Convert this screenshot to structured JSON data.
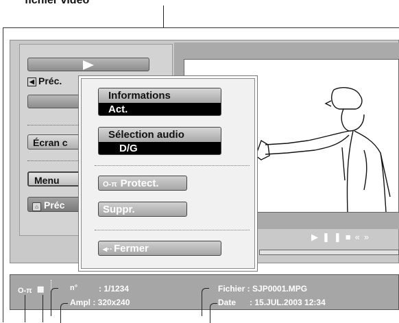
{
  "caption": "fichier vidéo",
  "left_panel": {
    "prev_label": "Préc.",
    "ecran_label": "Écran c",
    "menu_label": "Menu",
    "precedent_label": "Préc"
  },
  "popup": {
    "info_title": "Informations",
    "info_value": "Act.",
    "audio_title": "Sélection audio",
    "audio_value": "D/G",
    "protect_label": "Protect.",
    "suppr_label": "Suppr.",
    "fermer_label": "Fermer"
  },
  "info_bar": {
    "number": ": 1/1234",
    "size": "Ampl : 320x240",
    "file": "Fichier : SJP0001.MPG",
    "date": "Date      : 15.JUL.2003 12:34"
  },
  "icons": {
    "protect": "key-icon",
    "prev": "arrow-left-icon",
    "home": "home-icon",
    "play": "play-icon",
    "pause": "pause-icon",
    "stop": "stop-icon",
    "rewind": "rewind-icon",
    "forward": "fast-forward-icon"
  }
}
